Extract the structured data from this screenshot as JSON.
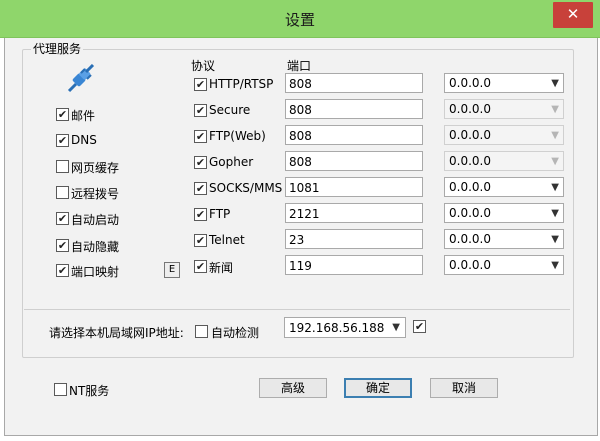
{
  "window": {
    "title": "设置",
    "close": "✕"
  },
  "group": {
    "legend": "代理服务",
    "protocol_header": "协议",
    "port_header": "端口"
  },
  "left_options": [
    {
      "label": "邮件",
      "checked": true
    },
    {
      "label": "DNS",
      "checked": true
    },
    {
      "label": "网页缓存",
      "checked": false
    },
    {
      "label": "远程拨号",
      "checked": false
    },
    {
      "label": "自动启动",
      "checked": true
    },
    {
      "label": "自动隐藏",
      "checked": true
    },
    {
      "label": "端口映射",
      "checked": true
    }
  ],
  "e_button": "E",
  "protocols": [
    {
      "name": "HTTP/RTSP",
      "checked": true,
      "port": "808",
      "ip": "0.0.0.0",
      "ip_enabled": true
    },
    {
      "name": "Secure",
      "checked": true,
      "port": "808",
      "ip": "0.0.0.0",
      "ip_enabled": false
    },
    {
      "name": "FTP(Web)",
      "checked": true,
      "port": "808",
      "ip": "0.0.0.0",
      "ip_enabled": false
    },
    {
      "name": "Gopher",
      "checked": true,
      "port": "808",
      "ip": "0.0.0.0",
      "ip_enabled": false
    },
    {
      "name": "SOCKS/MMS",
      "checked": true,
      "port": "1081",
      "ip": "0.0.0.0",
      "ip_enabled": true
    },
    {
      "name": "FTP",
      "checked": true,
      "port": "2121",
      "ip": "0.0.0.0",
      "ip_enabled": true
    },
    {
      "name": "Telnet",
      "checked": true,
      "port": "23",
      "ip": "0.0.0.0",
      "ip_enabled": true
    },
    {
      "name": "新闻",
      "checked": true,
      "port": "119",
      "ip": "0.0.0.0",
      "ip_enabled": true
    }
  ],
  "lan": {
    "prompt": "请选择本机局域网IP地址:",
    "auto_detect_label": "自动检测",
    "auto_detect_checked": false,
    "ip_value": "192.168.56.188",
    "extra_checked": true
  },
  "footer": {
    "nt_service_label": "NT服务",
    "nt_service_checked": false,
    "advanced": "高级",
    "ok": "确定",
    "cancel": "取消"
  },
  "icons": {
    "close": "close-icon",
    "plug": "plug-icon",
    "dropdown": "chevron-down-icon"
  }
}
